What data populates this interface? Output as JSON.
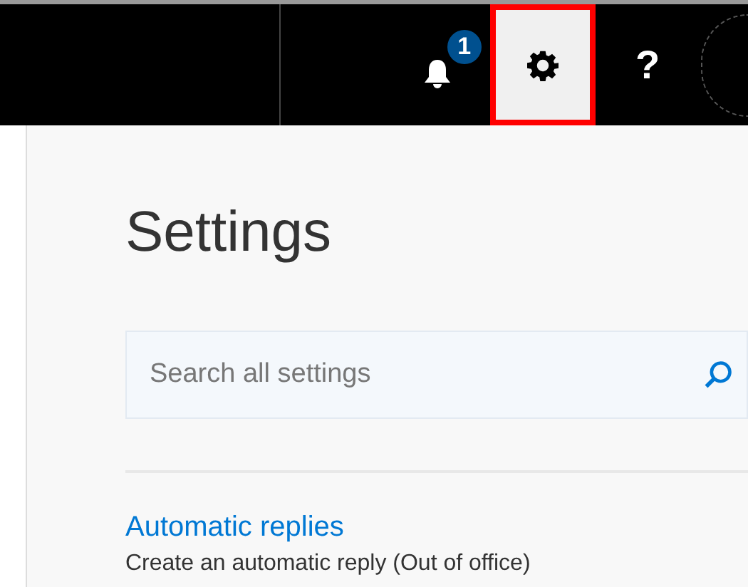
{
  "toolbar": [
    {
      "kind": "bell",
      "badge": "1",
      "selected": false,
      "highlighted": false
    },
    {
      "kind": "gear",
      "selected": true,
      "highlighted": true
    },
    {
      "kind": "help",
      "label": "?",
      "selected": false,
      "highlighted": false
    },
    {
      "kind": "avatar",
      "selected": false,
      "highlighted": false
    }
  ],
  "settings": {
    "title": "Settings",
    "search": {
      "placeholder": "Search all settings"
    },
    "items": [
      {
        "title": "Automatic replies",
        "description": "Create an automatic reply (Out of office)"
      }
    ]
  }
}
